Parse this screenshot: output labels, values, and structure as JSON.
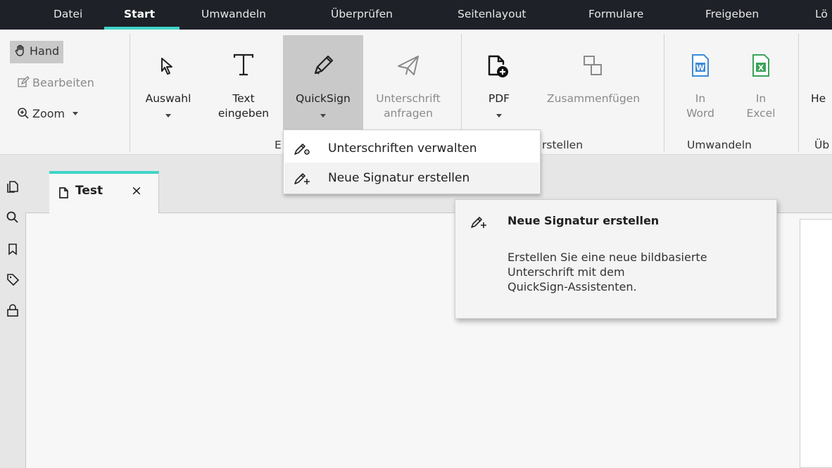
{
  "menubar": {
    "tabs": [
      {
        "label": "Datei"
      },
      {
        "label": "Start"
      },
      {
        "label": "Umwandeln"
      },
      {
        "label": "Überprüfen"
      },
      {
        "label": "Seitenlayout"
      },
      {
        "label": "Formulare"
      },
      {
        "label": "Freigeben"
      },
      {
        "label": "Lö"
      }
    ],
    "active_tab": "Start",
    "accent_color": "#3fd4c8"
  },
  "ribbon": {
    "navigation": {
      "hand_label": "Hand",
      "edit_label": "Bearbeiten",
      "zoom_label": "Zoom"
    },
    "edit_group": {
      "select_label": "Auswahl",
      "text_label_line1": "Text",
      "text_label_line2": "eingeben",
      "quicksign_label": "QuickSign",
      "request_label_line1": "Unterschrift",
      "request_label_line2": "anfragen",
      "group_label_visible": "E"
    },
    "create_group": {
      "pdf_label": "PDF",
      "merge_label": "Zusammenfügen",
      "group_label_visible": "rstellen"
    },
    "convert_group": {
      "word_line1": "In",
      "word_line2": "Word",
      "excel_line1": "In",
      "excel_line2": "Excel",
      "group_label": "Umwandeln"
    },
    "partial_group": {
      "button_label": "He",
      "group_label": "Üb"
    }
  },
  "sidebar": {
    "icons": [
      "pages-icon",
      "search-icon",
      "bookmark-icon",
      "tag-icon",
      "lock-icon"
    ]
  },
  "document": {
    "tab_title": "Test",
    "close_symbol": "×"
  },
  "dropdown": {
    "items": [
      {
        "label": "Unterschriften verwalten",
        "icon": "pen-gear-icon"
      },
      {
        "label": "Neue Signatur erstellen",
        "icon": "pen-plus-icon"
      }
    ]
  },
  "tooltip": {
    "title": "Neue Signatur erstellen",
    "body_line1": "Erstellen Sie eine neue bildbasierte",
    "body_line2": "Unterschrift mit dem",
    "body_line3": "QuickSign-Assistenten."
  }
}
